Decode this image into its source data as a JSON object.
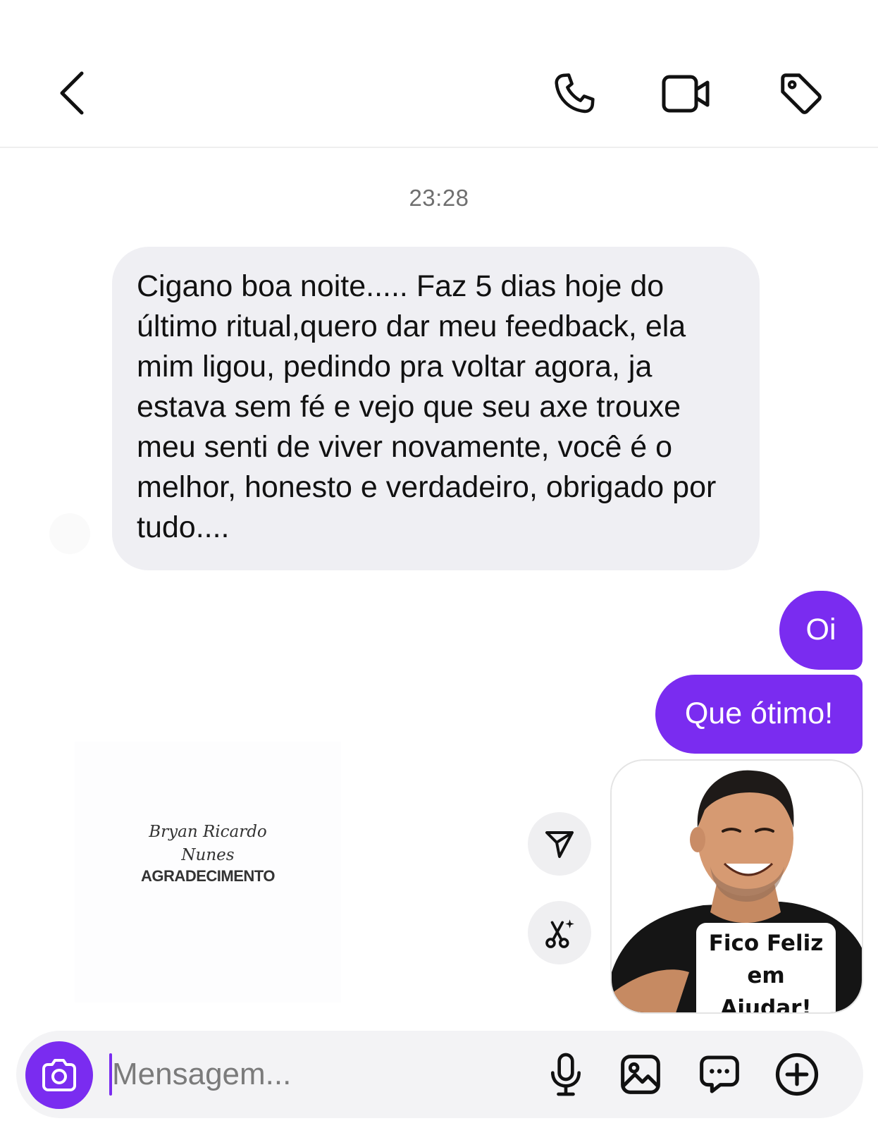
{
  "header": {
    "contact_name": "",
    "icons": {
      "back": "chevron-left-icon",
      "call": "phone-icon",
      "video": "video-camera-icon",
      "tag": "tag-icon"
    }
  },
  "thread": {
    "timestamp": "23:28",
    "received_message": "Cigano boa noite..... Faz 5 dias hoje do último ritual,quero dar meu feedback, ela mim ligou, pedindo pra voltar agora, ja estava sem fé e vejo que seu axe trouxe meu senti de viver novamente, você é o melhor, honesto e verdadeiro, obrigado por tudo....",
    "sent_messages": [
      "Oi",
      "Que ótimo!"
    ],
    "shared_card": {
      "script_line_1": "Bryan Ricardo",
      "script_line_2": "Nunes",
      "title": "AGRADECIMENTO"
    },
    "sticker": {
      "caption_line_1": "Fico Feliz",
      "caption_line_2": "em Ajudar!"
    },
    "actions": {
      "share": "paper-plane-icon",
      "cut": "scissors-sparkle-icon"
    }
  },
  "composer": {
    "placeholder": "Mensagem...",
    "value": "",
    "icons": {
      "camera": "camera-icon",
      "mic": "microphone-icon",
      "gallery": "image-icon",
      "sticker": "chat-bubble-icon",
      "plus": "plus-circle-icon"
    }
  },
  "colors": {
    "accent": "#7a2cf0",
    "received_bubble": "#efeff3",
    "timestamp": "#6f6f6f"
  }
}
